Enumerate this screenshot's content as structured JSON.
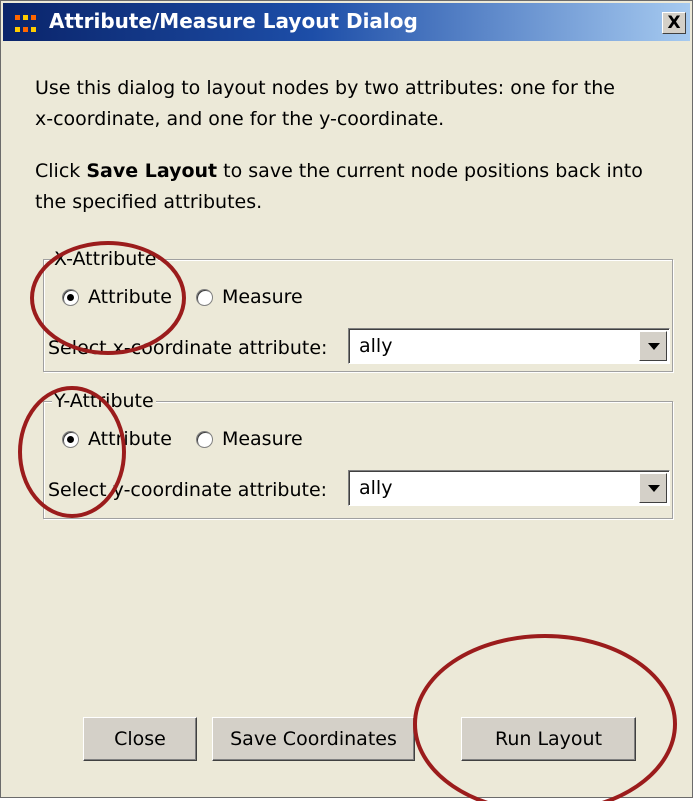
{
  "window": {
    "title": "Attribute/Measure Layout Dialog",
    "close_glyph": "X"
  },
  "instructions": {
    "line1": "Use this dialog to layout nodes by two attributes: one for the",
    "line2": "x-coordinate, and one for the y-coordinate.",
    "line3_prefix": "Click ",
    "line3_bold": "Save Layout",
    "line3_suffix": " to save the current node positions back into",
    "line4": "the specified attributes."
  },
  "x_group": {
    "title": "X-Attribute",
    "option_attribute": "Attribute",
    "option_measure": "Measure",
    "selected": "Attribute",
    "select_label": "Select x-coordinate attribute:",
    "select_value": "ally"
  },
  "y_group": {
    "title": "Y-Attribute",
    "option_attribute": "Attribute",
    "option_measure": "Measure",
    "selected": "Attribute",
    "select_label": "Select y-coordinate attribute:",
    "select_value": "ally"
  },
  "buttons": {
    "close": "Close",
    "save": "Save Coordinates",
    "run": "Run Layout"
  },
  "colors": {
    "title_start": "#0a246a",
    "title_end": "#a6caf0",
    "dialog_bg": "#ece9d8",
    "annotation": "#9b1c1c",
    "app_icon_accent": "#ff6600"
  }
}
